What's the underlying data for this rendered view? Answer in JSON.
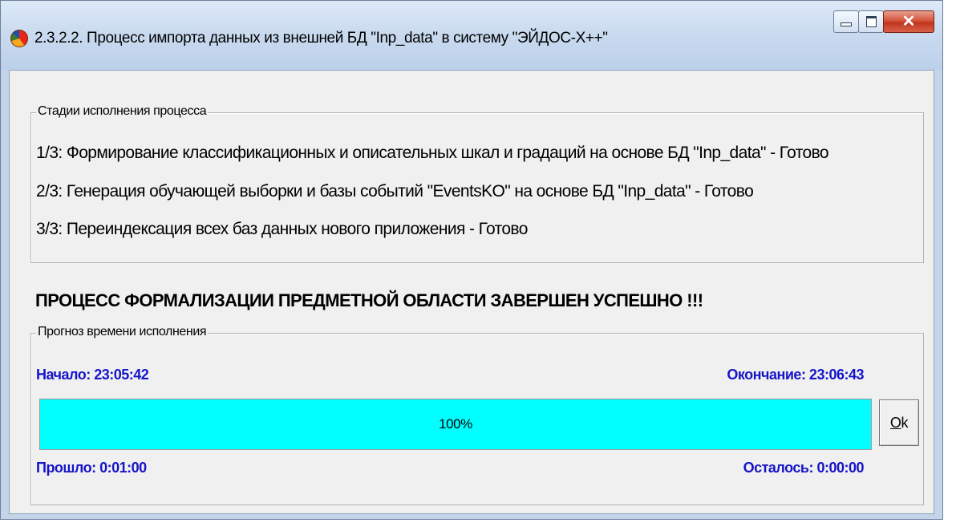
{
  "window": {
    "title": "2.3.2.2. Процесс импорта данных из внешней БД \"Inp_data\" в систему \"ЭЙДОС-X++\"",
    "icon": "eidos-app-icon"
  },
  "stages": {
    "legend": "Стадии исполнения процесса",
    "items": [
      "1/3: Формирование классификационных и описательных шкал и градаций на основе БД \"Inp_data\" - Готово",
      "2/3: Генерация обучающей выборки и базы событий \"EventsKO\" на основе БД \"Inp_data\" - Готово",
      "3/3: Переиндексация всех баз данных нового приложения - Готово"
    ]
  },
  "status_message": "ПРОЦЕСС ФОРМАЛИЗАЦИИ ПРЕДМЕТНОЙ ОБЛАСТИ ЗАВЕРШЕН УСПЕШНО !!!",
  "forecast": {
    "legend": "Прогноз времени исполнения",
    "start": "Начало: 23:05:42",
    "end": "Окончание: 23:06:43",
    "elapsed": "Прошло: 0:01:00",
    "remaining": "Осталось: 0:00:00",
    "progress_percent": 100,
    "progress_label": "100%",
    "progress_color": "#00ffff",
    "label_color": "#1515c8"
  },
  "ok_button": {
    "mnemonic": "O",
    "rest": "k"
  }
}
